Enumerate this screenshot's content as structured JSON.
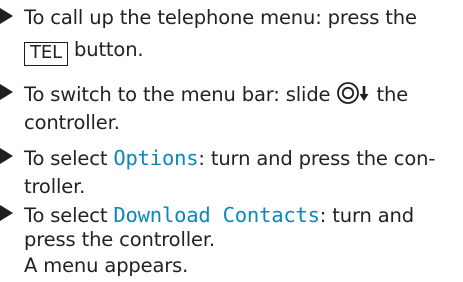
{
  "steps": [
    {
      "line1_before": "To call up the telephone menu: press the",
      "key_label": "TEL",
      "line2_after": " button."
    },
    {
      "line1_before": "To switch to the menu bar: slide ",
      "icon": "controller-slide-down-icon",
      "line1_after": " the",
      "line2": "controller."
    },
    {
      "line1_before": "To select ",
      "mono": "Options",
      "line1_after": ": turn and press the con-",
      "line2": "troller."
    },
    {
      "line1_before": "To select ",
      "mono": "Download Contacts",
      "line1_after": ": turn and",
      "line2": "press the controller.",
      "result": "A menu appears."
    }
  ],
  "colors": {
    "text": "#222222",
    "highlight": "#0a88b8"
  }
}
